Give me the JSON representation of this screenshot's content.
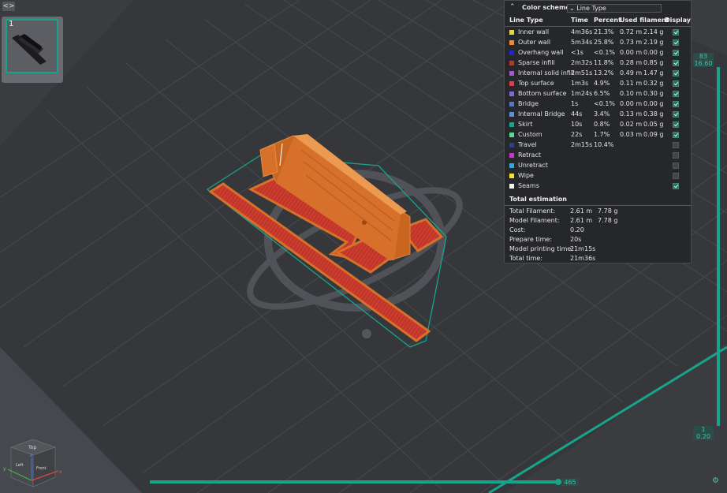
{
  "toolbar": {
    "toggle_label": "<>"
  },
  "plate_thumb": {
    "number": "1"
  },
  "panel": {
    "title": "Color scheme",
    "select_value": "Line Type",
    "headers": {
      "line_type": "Line Type",
      "time": "Time",
      "percent": "Percent",
      "used": "Used filament",
      "display": "Display"
    },
    "rows": [
      {
        "name": "Inner wall",
        "time": "4m36s",
        "percent": "21.3%",
        "len": "0.72 m",
        "weight": "2.14 g",
        "color": "#e6d648",
        "display": true
      },
      {
        "name": "Outer wall",
        "time": "5m34s",
        "percent": "25.8%",
        "len": "0.73 m",
        "weight": "2.19 g",
        "color": "#ee8a3a",
        "display": true
      },
      {
        "name": "Overhang wall",
        "time": "<1s",
        "percent": "<0.1%",
        "len": "0.00 m",
        "weight": "0.00 g",
        "color": "#2427c4",
        "display": true
      },
      {
        "name": "Sparse infill",
        "time": "2m32s",
        "percent": "11.8%",
        "len": "0.28 m",
        "weight": "0.85 g",
        "color": "#b33a2a",
        "display": true
      },
      {
        "name": "Internal solid infill",
        "time": "2m51s",
        "percent": "13.2%",
        "len": "0.49 m",
        "weight": "1.47 g",
        "color": "#a05ad0",
        "display": true
      },
      {
        "name": "Top surface",
        "time": "1m3s",
        "percent": "4.9%",
        "len": "0.11 m",
        "weight": "0.32 g",
        "color": "#e8394a",
        "display": true
      },
      {
        "name": "Bottom surface",
        "time": "1m24s",
        "percent": "6.5%",
        "len": "0.10 m",
        "weight": "0.30 g",
        "color": "#7d6ad8",
        "display": true
      },
      {
        "name": "Bridge",
        "time": "1s",
        "percent": "<0.1%",
        "len": "0.00 m",
        "weight": "0.00 g",
        "color": "#4f7ac0",
        "display": true
      },
      {
        "name": "Internal Bridge",
        "time": "44s",
        "percent": "3.4%",
        "len": "0.13 m",
        "weight": "0.38 g",
        "color": "#5f8ed8",
        "display": true
      },
      {
        "name": "Skirt",
        "time": "10s",
        "percent": "0.8%",
        "len": "0.02 m",
        "weight": "0.05 g",
        "color": "#16a58b",
        "display": true
      },
      {
        "name": "Custom",
        "time": "22s",
        "percent": "1.7%",
        "len": "0.03 m",
        "weight": "0.09 g",
        "color": "#5ed88e",
        "display": true
      },
      {
        "name": "Travel",
        "time": "2m15s",
        "percent": "10.4%",
        "len": "",
        "weight": "",
        "color": "#2c3f8a",
        "display": false
      },
      {
        "name": "Retract",
        "time": "",
        "percent": "",
        "len": "",
        "weight": "",
        "color": "#c537c8",
        "display": false
      },
      {
        "name": "Unretract",
        "time": "",
        "percent": "",
        "len": "",
        "weight": "",
        "color": "#36a6d9",
        "display": false
      },
      {
        "name": "Wipe",
        "time": "",
        "percent": "",
        "len": "",
        "weight": "",
        "color": "#f2e52a",
        "display": false
      },
      {
        "name": "Seams",
        "time": "",
        "percent": "",
        "len": "",
        "weight": "",
        "color": "#f4f4f4",
        "display": true
      }
    ],
    "total_title": "Total estimation",
    "totals": [
      {
        "label": "Total Filament:",
        "a": "2.61 m",
        "b": "7.78 g"
      },
      {
        "label": "Model Filament:",
        "a": "2.61 m",
        "b": "7.78 g"
      },
      {
        "label": "Cost:",
        "a": "0.20",
        "b": ""
      },
      {
        "label": "Prepare time:",
        "a": "20s",
        "b": ""
      },
      {
        "label": "Model printing time:",
        "a": "21m15s",
        "b": ""
      },
      {
        "label": "Total time:",
        "a": "21m36s",
        "b": ""
      }
    ]
  },
  "vslider": {
    "top_layer": "83",
    "top_height": "16.60",
    "bottom_layer": "1",
    "bottom_height": "0.20"
  },
  "hslider": {
    "value": "465"
  },
  "navcube": {
    "top": "Top",
    "front": "Front",
    "left": "Left",
    "x": "x",
    "y": "y",
    "z": "z"
  },
  "colors": {
    "accent": "#16a58b",
    "model": "#d6702a",
    "top_surface": "#c0302a",
    "panel_bg": "#26272b",
    "canvas": "#3b3c40"
  }
}
